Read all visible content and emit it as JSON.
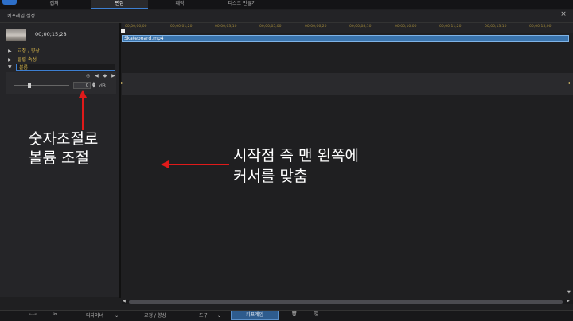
{
  "top_tabs": [
    "캡처",
    "편집",
    "제작",
    "디스크 만들기"
  ],
  "active_tab": "편집",
  "dialog": {
    "title": "키프레임 설정",
    "close": "×"
  },
  "clip_panel": {
    "timecode": "00;00;15;28"
  },
  "tree": {
    "items": [
      {
        "arrow": "▶",
        "label": "교정 / 향상"
      },
      {
        "arrow": "▶",
        "label": "클립 속성"
      },
      {
        "arrow": "▼",
        "label": "볼륨"
      }
    ]
  },
  "volume": {
    "value": "0",
    "unit": "dB",
    "nav_icons": "◎ ◀ ◆ ▶"
  },
  "ruler": {
    "ticks": [
      "00;00;00;00",
      "00;00;01;20",
      "00;00;03;10",
      "00;00;05;00",
      "00;00;06;20",
      "00;00;08;10",
      "00;00;10;00",
      "00;00;11;20",
      "00;00;13;10",
      "00;00;15;00"
    ]
  },
  "clip": {
    "name": "Skateboard.mp4"
  },
  "toolbar": {
    "designer": "디자이너",
    "fix_enhance": "교정 / 향상",
    "tools": "도구",
    "keyframe": "키프레임"
  },
  "annotations": {
    "left_line1": "숫자조절로",
    "left_line2": "볼륨 조절",
    "right_line1": "시작점 즉 맨 왼쪽에",
    "right_line2": "커서를 맞춤"
  },
  "colors": {
    "accent": "#3d7fd1",
    "playhead": "#d23333",
    "annotation_arrow": "#e01a1a",
    "keyframe_label": "#d8b64a"
  }
}
